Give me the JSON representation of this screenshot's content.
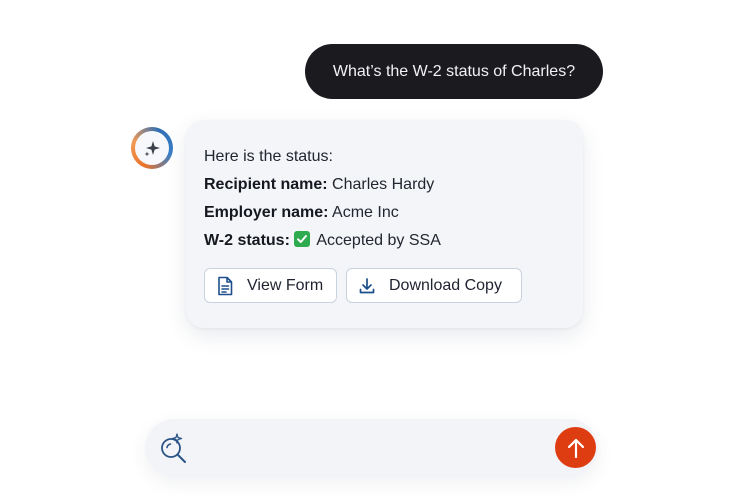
{
  "user_message": {
    "text": "What’s the W-2 status of Charles?"
  },
  "assistant": {
    "avatar_icon": "sparkle-icon",
    "intro": "Here is the status:",
    "fields": {
      "recipient_label": "Recipient name:",
      "recipient_value": "Charles Hardy",
      "employer_label": "Employer name:",
      "employer_value": "Acme Inc",
      "status_label": "W-2 status:",
      "status_icon": "check-mark-icon",
      "status_value": "Accepted by SSA"
    },
    "actions": {
      "view_form": {
        "label": "View Form",
        "icon": "document-icon"
      },
      "download": {
        "label": "Download Copy",
        "icon": "download-icon"
      }
    }
  },
  "composer": {
    "placeholder": "",
    "search_icon": "search-sparkle-icon",
    "send_icon": "arrow-up-icon",
    "send_color": "#de3d12"
  },
  "colors": {
    "user_bubble": "#1b1b1f",
    "card_background": "#f3f5f9",
    "status_check": "#2eaa4f",
    "icon_blue": "#1d4f8c"
  }
}
